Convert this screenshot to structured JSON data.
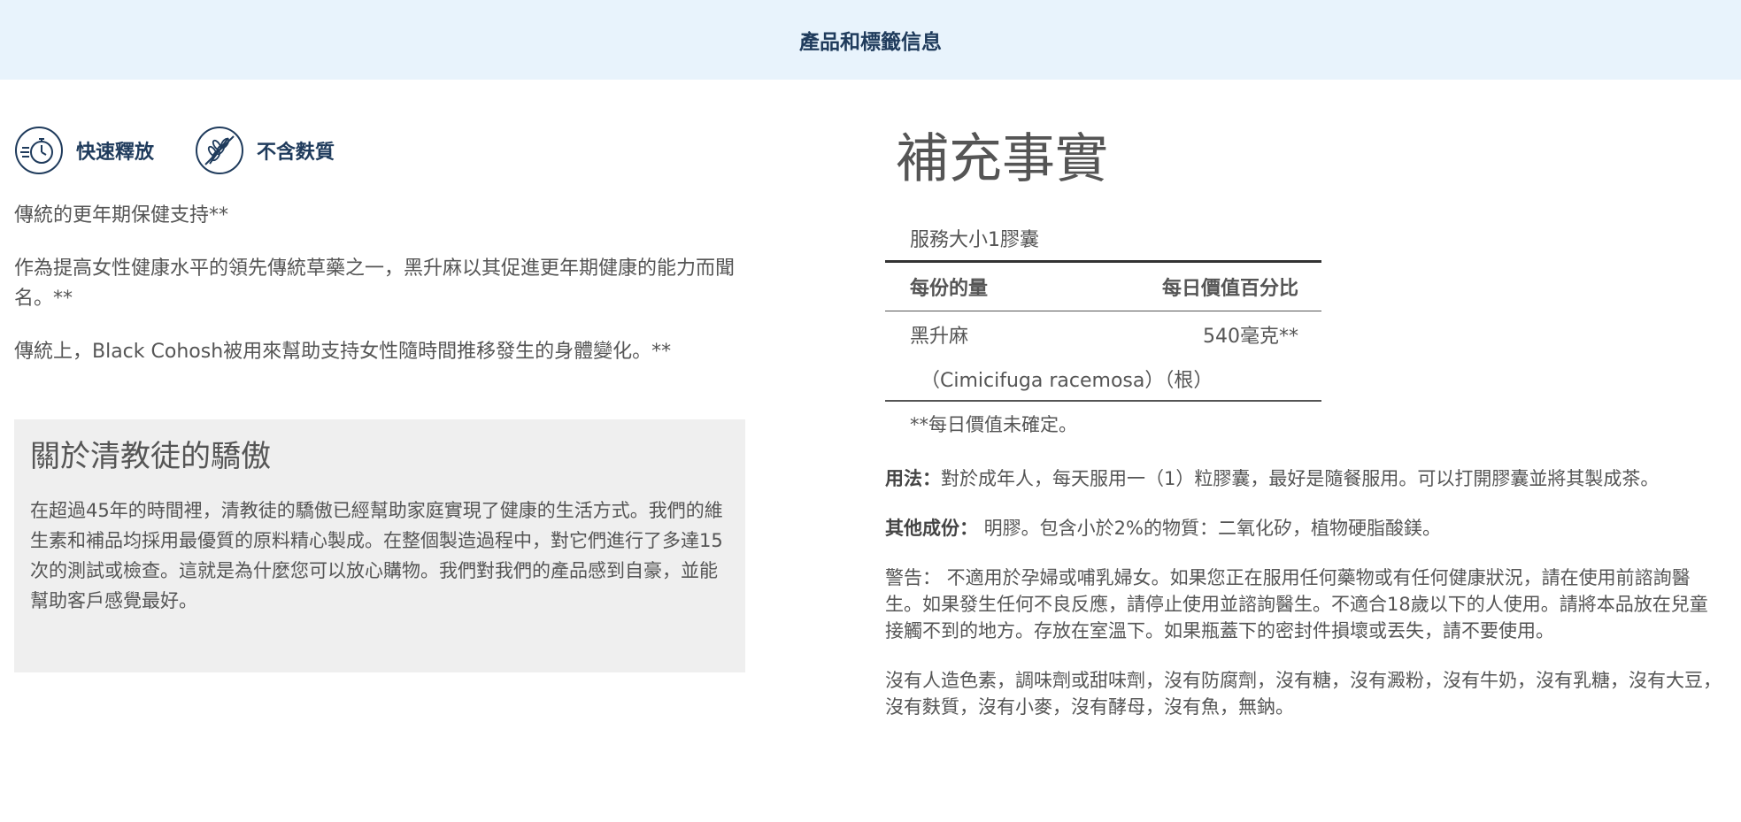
{
  "header": {
    "title": "產品和標籤信息"
  },
  "badges": [
    {
      "icon": "stopwatch-icon",
      "label": "快速釋放"
    },
    {
      "icon": "wheat-icon",
      "label": "不含麩質"
    }
  ],
  "left": {
    "tagline": "傳統的更年期保健支持**",
    "paragraphs": [
      "作為提高女性健康水平的領先傳統草藥之一，黑升麻以其促進更年期健康的能力而聞名。**",
      "傳統上，Black Cohosh被用來幫助支持女性隨時間推移發生的身體變化。**"
    ]
  },
  "about": {
    "title": "關於清教徒的驕傲",
    "body": "在超過45年的時間裡，清教徒的驕傲已經幫助家庭實現了健康的生活方式。我們的維生素和補品均採用最優質的原料精心製成。在整個製造過程中，對它們進行了多達15次的測試或檢查。這就是為什麼您可以放心購物。我們對我們的產品感到自豪，並能幫助客戶感覺最好。"
  },
  "facts": {
    "title": "補充事實",
    "serving": "服務大小1膠囊",
    "col_amount": "每份的量",
    "col_dv": "每日價值百分比",
    "ingredient_name": "黑升麻",
    "ingredient_amount": "540毫克**",
    "ingredient_sub": "（Cimicifuga racemosa）（根）",
    "note": "**每日價值未確定。"
  },
  "directions": {
    "label": "用法：",
    "text": "對於成年人，每天服用一（1）粒膠囊，最好是隨餐服用。可以打開膠囊並將其製成茶。"
  },
  "other_ingredients": {
    "label": "其他成份：",
    "text": " 明膠。包含小於2%的物質：二氧化矽，植物硬脂酸鎂。"
  },
  "warning": {
    "text": "警告： 不適用於孕婦或哺乳婦女。如果您正在服用任何藥物或有任何健康狀況，請在使用前諮詢醫生。如果發生任何不良反應，請停止使用並諮詢醫生。不適合18歲以下的人使用。請將本品放在兒童接觸不到的地方。存放在室溫下。如果瓶蓋下的密封件損壞或丟失，請不要使用。"
  },
  "free_of": {
    "text": "沒有人造色素，調味劑或甜味劑，沒有防腐劑，沒有糖，沒有澱粉，沒有牛奶，沒有乳糖，沒有大豆，沒有麩質，沒有小麥，沒有酵母，沒有魚，無鈉。"
  },
  "colors": {
    "header_bg": "#e8f3fc",
    "header_text": "#1f3b5c",
    "body_text": "#555555",
    "about_bg": "#efefef"
  }
}
